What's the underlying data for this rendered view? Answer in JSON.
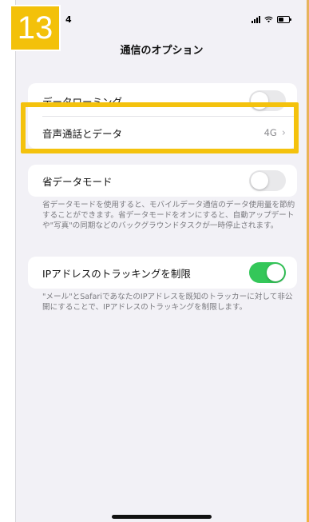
{
  "badge": {
    "step_number": "13"
  },
  "status_bar": {
    "time": "4"
  },
  "nav": {
    "title": "通信のオプション"
  },
  "cellular_group": {
    "data_roaming": {
      "label": "データローミング",
      "toggle_on": false
    },
    "voice_and_data": {
      "label": "音声通話とデータ",
      "value": "4G"
    }
  },
  "low_data_mode": {
    "label": "省データモード",
    "toggle_on": false,
    "footnote": "省データモードを使用すると、モバイルデータ通信のデータ使用量を節約することができます。省データモードをオンにすると、自動アップデートや\"写真\"の同期などのバックグラウンドタスクが一時停止されます。"
  },
  "ip_tracking": {
    "label": "IPアドレスのトラッキングを制限",
    "toggle_on": true,
    "footnote": "\"メール\"とSafariであなたのIPアドレスを既知のトラッカーに対して非公開にすることで、IPアドレスのトラッキングを制限します。"
  },
  "colors": {
    "highlight": "#f4c20d",
    "toggle_on": "#34c759",
    "background": "#f2f1f6"
  }
}
